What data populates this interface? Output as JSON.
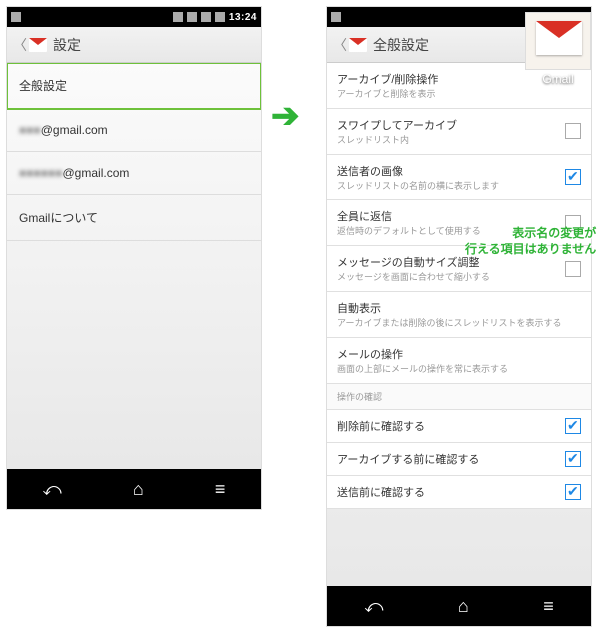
{
  "domain": "Computer-Use",
  "statusbar": {
    "time": "13:24"
  },
  "left_phone": {
    "actionbar_title": "設定",
    "items": [
      {
        "label": "全般設定",
        "highlight": true
      },
      {
        "label_prefix_blurred": "■■■",
        "label_suffix": "@gmail.com"
      },
      {
        "label_prefix_blurred": "■■■■■■",
        "label_suffix": "@gmail.com"
      },
      {
        "label": "Gmailについて"
      }
    ]
  },
  "right_phone": {
    "actionbar_title": "全般設定",
    "rows": [
      {
        "title": "アーカイブ/削除操作",
        "sub": "アーカイブと削除を表示"
      },
      {
        "title": "スワイプしてアーカイブ",
        "sub": "スレッドリスト内",
        "checkbox": "off"
      },
      {
        "title": "送信者の画像",
        "sub": "スレッドリストの名前の横に表示します",
        "checkbox": "on"
      },
      {
        "title": "全員に返信",
        "sub": "返信時のデフォルトとして使用する",
        "checkbox": "off"
      },
      {
        "title": "メッセージの自動サイズ調整",
        "sub": "メッセージを画面に合わせて縮小する",
        "checkbox": "off"
      },
      {
        "title": "自動表示",
        "sub": "アーカイブまたは削除の後にスレッドリストを表示する"
      },
      {
        "title": "メールの操作",
        "sub": "画面の上部にメールの操作を常に表示する"
      },
      {
        "section": "操作の確認"
      },
      {
        "title": "削除前に確認する",
        "checkbox": "on"
      },
      {
        "title": "アーカイブする前に確認する",
        "checkbox": "on"
      },
      {
        "title": "送信前に確認する",
        "checkbox": "on"
      }
    ]
  },
  "app_icon": {
    "label": "Gmail"
  },
  "annotation": {
    "line1": "表示名の変更が",
    "line2": "行える項目はありません"
  },
  "arrow": "➔"
}
